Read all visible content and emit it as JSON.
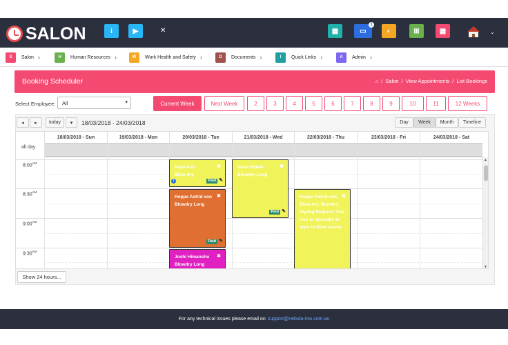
{
  "brand": {
    "name": "SALON"
  },
  "header_icons": [
    {
      "icon": "info-icon",
      "color": "#29b6f6",
      "glyph": "i"
    },
    {
      "icon": "video-icon",
      "color": "#29b6f6",
      "glyph": "▶"
    },
    {
      "icon": "expand-icon",
      "color": "",
      "glyph": "✕"
    },
    {
      "icon": "calendar-check-icon",
      "color": "#20b2aa",
      "glyph": "▦"
    },
    {
      "icon": "chat-icon",
      "color": "#2c6ee0",
      "glyph": "▭",
      "badge": "1"
    },
    {
      "icon": "dashboard-icon",
      "color": "#f5a623",
      "glyph": "◐"
    },
    {
      "icon": "cart-icon",
      "color": "#6ab04c",
      "glyph": "⊞"
    },
    {
      "icon": "calendar-icon",
      "color": "#f44a72",
      "glyph": "▦"
    }
  ],
  "nav": [
    {
      "letter": "S",
      "label": "Salon",
      "color": "#f44a72"
    },
    {
      "letter": "H",
      "label": "Human Resources",
      "color": "#6ab04c"
    },
    {
      "letter": "W",
      "label": "Work Health and Safety",
      "color": "#f5a623"
    },
    {
      "letter": "D",
      "label": "Documents",
      "color": "#a0524d"
    },
    {
      "letter": "I",
      "label": "Quick Links",
      "color": "#20a0a0"
    },
    {
      "letter": "A",
      "label": "Admin",
      "color": "#7b68ee"
    }
  ],
  "panel": {
    "title": "Booking Scheduler",
    "crumbs": [
      "Salon",
      "View Appointments",
      "List Bookings"
    ]
  },
  "employee": {
    "label": "Select Employee:",
    "value": "All"
  },
  "week_buttons": [
    "Current Week",
    "Next Week",
    "2",
    "3",
    "4",
    "5",
    "6",
    "7",
    "8",
    "9",
    "10",
    "11",
    "12 Weeks"
  ],
  "calendar": {
    "today_label": "today",
    "range": "18/03/2018 - 24/03/2018",
    "views": [
      "Day",
      "Week",
      "Month",
      "Timeline"
    ],
    "active_view": "Week",
    "days": [
      "18/03/2018 - Sun",
      "19/03/2018 - Mon",
      "20/03/2018 - Tue",
      "21/03/2018 - Wed",
      "22/03/2018 - Thu",
      "23/03/2018 - Fri",
      "24/03/2018 - Sat"
    ],
    "allday_label": "all day",
    "times": [
      {
        "t": "8:00",
        "ampm": "AM"
      },
      {
        "t": "8:30",
        "ampm": "AM"
      },
      {
        "t": "9:00",
        "ampm": "AM"
      },
      {
        "t": "9:30",
        "ampm": "AM"
      }
    ],
    "events": [
      {
        "name": "Patel Anil",
        "service": "Blow-dry",
        "day": 2,
        "color": "#f0f35a",
        "paid": "Paid"
      },
      {
        "name": "Hoppe Astrid von",
        "service": "Blowdry Long",
        "day": 2,
        "color": "#e07032",
        "paid": "Paid"
      },
      {
        "name": "Joshi Himanshu",
        "service": "Blowdry Long",
        "day": 2,
        "color": "#e020c0"
      },
      {
        "name": "Iwata Hideki",
        "service": "Blowdry Long",
        "day": 3,
        "color": "#f0f35a",
        "paid": "Paid"
      },
      {
        "name": "Hoppe Astrid von",
        "service": "Blow-dry, Blowdry Styling Request: Flat iron or specialty to style in Blow waves",
        "day": 4,
        "color": "#f0f35a"
      }
    ],
    "show24": "Show 24 hours..."
  },
  "footer": {
    "text": "For any technical issues please email on",
    "email": "support@nebula-ims.com.au"
  }
}
